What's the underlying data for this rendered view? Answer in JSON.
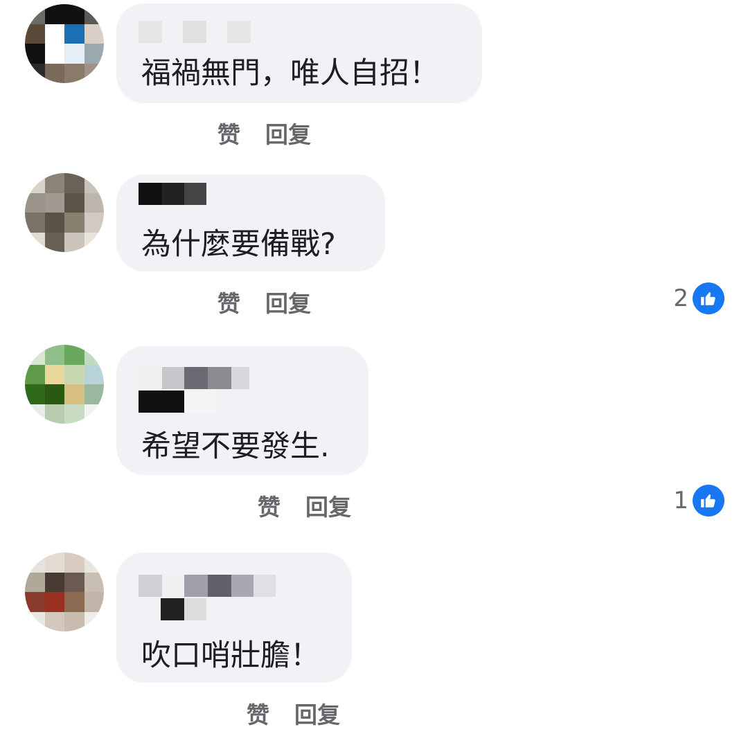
{
  "comments": [
    {
      "text": "福禍無門，唯人自招！",
      "like_label": "赞",
      "reply_label": "回复",
      "reaction_count": ""
    },
    {
      "text": "為什麼要備戰?",
      "like_label": "赞",
      "reply_label": "回复",
      "reaction_count": "2"
    },
    {
      "text": "希望不要發生.",
      "like_label": "赞",
      "reply_label": "回复",
      "reaction_count": "1"
    },
    {
      "text": "吹口哨壯膽！",
      "like_label": "赞",
      "reply_label": "回复",
      "reaction_count": ""
    }
  ],
  "colors": {
    "bubble": "#f0f2f5",
    "like_blue": "#1877f2",
    "action_text": "#65676b"
  },
  "icons": {
    "reaction": "like-thumb-icon"
  }
}
